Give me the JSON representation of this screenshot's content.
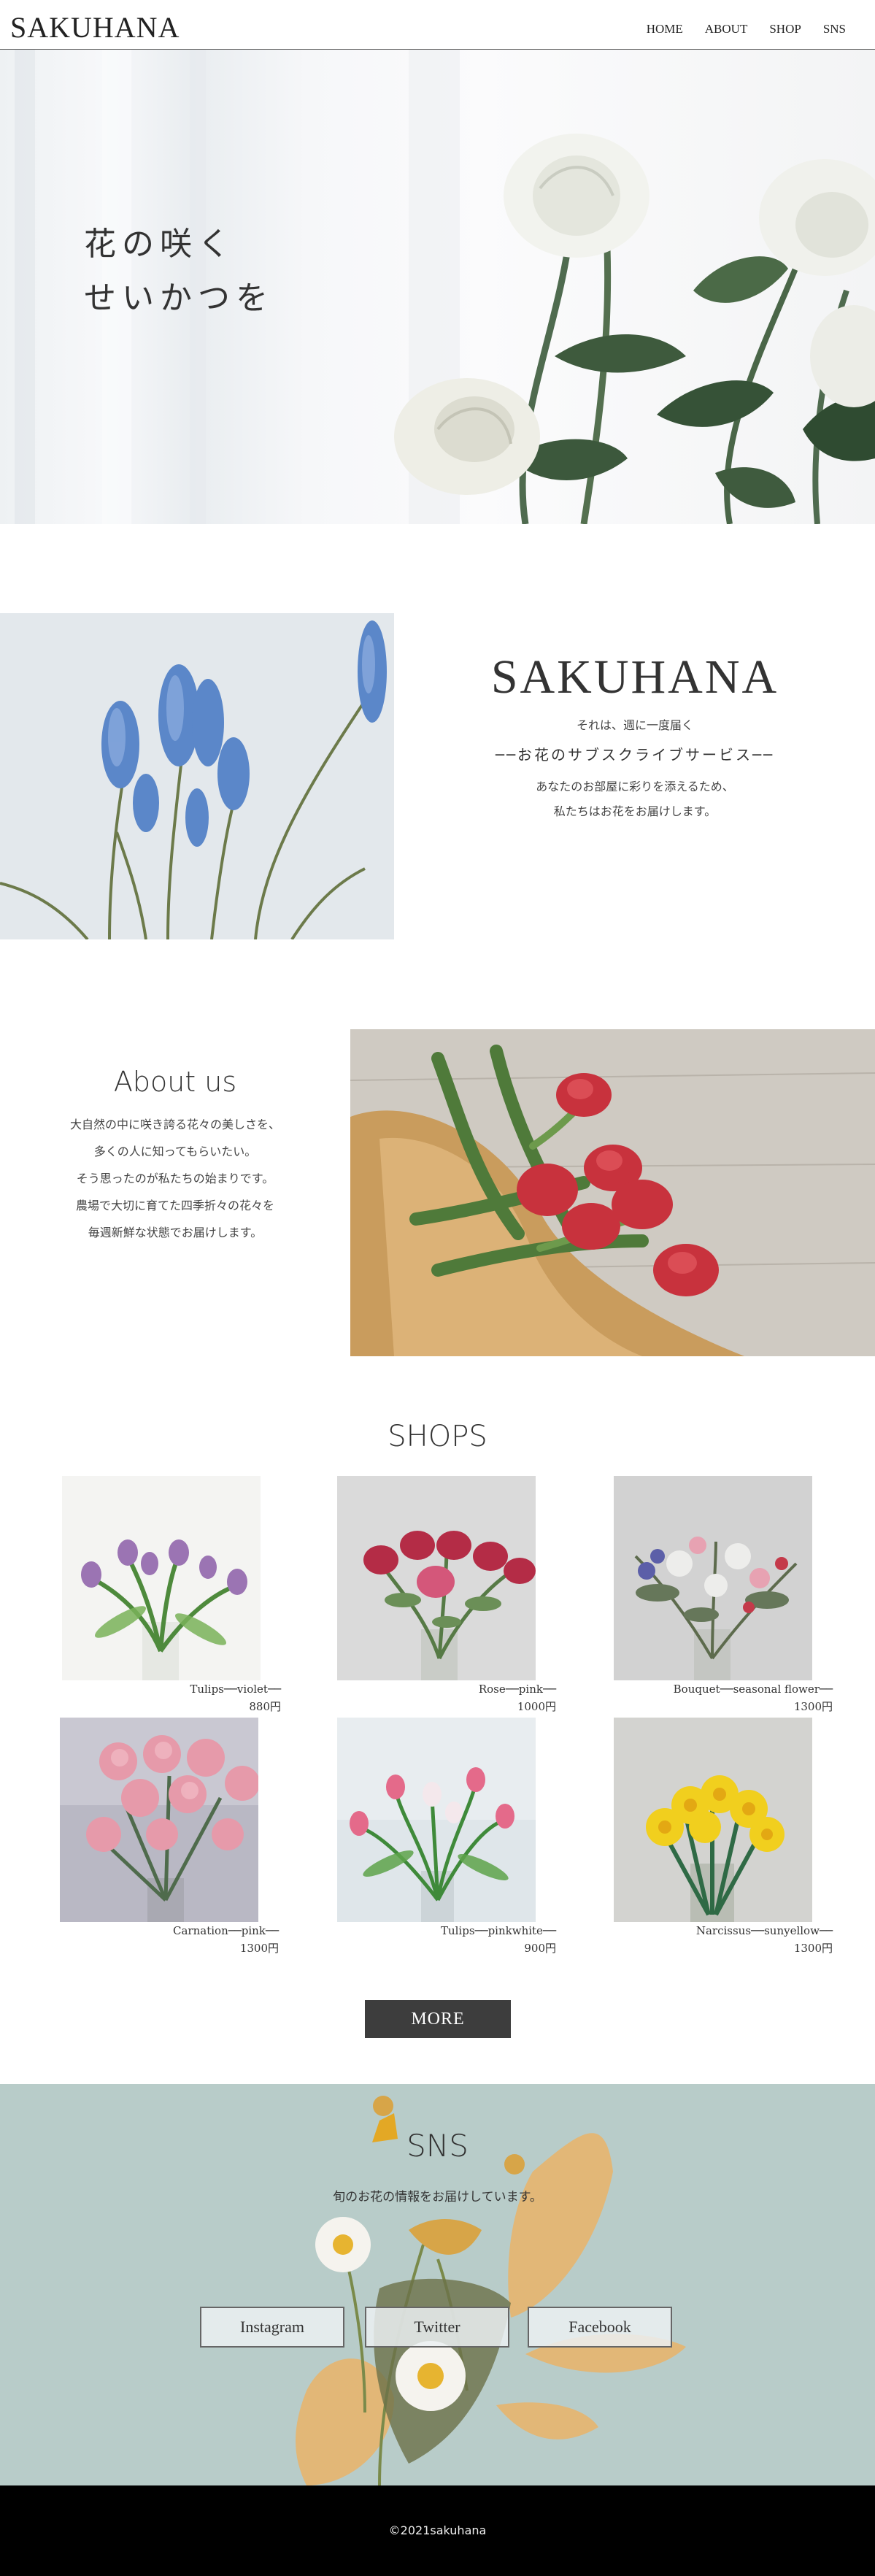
{
  "header": {
    "logo": "SAKUHANA",
    "nav": [
      "HOME",
      "ABOUT",
      "SHOP",
      "SNS"
    ]
  },
  "hero": {
    "line1": "花の咲く",
    "line2": "せいかつを"
  },
  "concept": {
    "title": "SAKUHANA",
    "sub1": "それは、週に一度届く",
    "sub2": "──お花のサブスクライブサービス──",
    "body1": "あなたのお部屋に彩りを添えるため、",
    "body2": "私たちはお花をお届けします。"
  },
  "about": {
    "title": "About us",
    "lines": [
      "大自然の中に咲き誇る花々の美しさを、",
      "多くの人に知ってもらいたい。",
      "そう思ったのが私たちの始まりです。",
      "農場で大切に育てた四季折々の花々を",
      "毎週新鮮な状態でお届けします。"
    ]
  },
  "shops": {
    "title": "SHOPS",
    "items": [
      {
        "name": "Tulips──violet──",
        "price": "880円"
      },
      {
        "name": "Rose──pink──",
        "price": "1000円"
      },
      {
        "name": "Bouquet──seasonal flower──",
        "price": "1300円"
      },
      {
        "name": "Carnation──pink──",
        "price": "1300円"
      },
      {
        "name": "Tulips──pinkwhite──",
        "price": "900円"
      },
      {
        "name": "Narcissus──sunyellow──",
        "price": "1300円"
      }
    ],
    "more": "MORE"
  },
  "sns": {
    "title": "SNS",
    "sub": "旬のお花の情報をお届けしています。",
    "buttons": [
      "Instagram",
      "Twitter",
      "Facebook"
    ]
  },
  "footer": {
    "copyright": "©2021sakuhana"
  }
}
